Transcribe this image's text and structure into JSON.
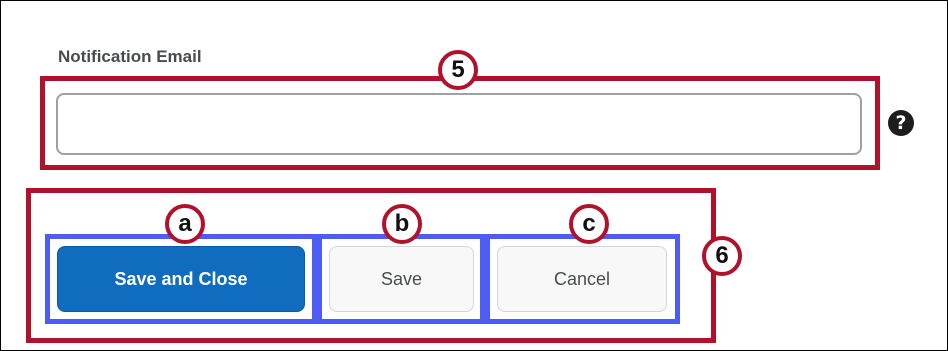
{
  "form": {
    "notification_email_label": "Notification Email",
    "notification_email_value": "",
    "help_glyph": "?"
  },
  "buttons": {
    "save_and_close": "Save and Close",
    "save": "Save",
    "cancel": "Cancel"
  },
  "callouts": {
    "field": "5",
    "save_and_close": "a",
    "save": "b",
    "cancel": "c",
    "button_group": "6"
  },
  "icons": {
    "help": "help-icon"
  },
  "colors": {
    "primary_button": "#0f6cbf",
    "callout_red": "#b0122b",
    "callout_blue": "#4d5cf2"
  }
}
